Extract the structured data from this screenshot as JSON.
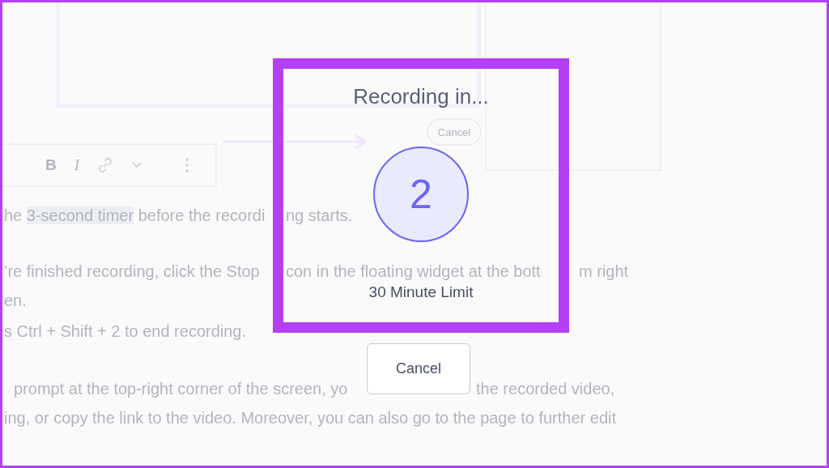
{
  "document": {
    "figure": {
      "button": "Cancel"
    },
    "toolbar": {
      "items": [
        {
          "kind": "bold",
          "label": "B"
        },
        {
          "kind": "italic",
          "label": "I"
        },
        {
          "kind": "link"
        },
        {
          "kind": "chevron"
        },
        {
          "kind": "more"
        }
      ]
    },
    "framed_lines": [
      {
        "left": [
          {
            "text": "he ",
            "highlighted": false
          },
          {
            "text": "3-second timer",
            "highlighted": true
          },
          {
            "text": " before the recordi",
            "highlighted": false
          }
        ],
        "inside": "ng starts."
      },
      {
        "left": [
          {
            "text": "’re finished recording, click the Stop",
            "highlighted": false
          }
        ],
        "inside": "con in the floating widget at the bott",
        "right": "m right"
      },
      {
        "left": [
          {
            "text": "en.",
            "highlighted": false
          }
        ]
      },
      {
        "left": [
          {
            "text": "s Ctrl + Shift + 2 to end recording.",
            "highlighted": false
          }
        ]
      }
    ],
    "lines": [
      {
        "text": "prompt at the top-right corner of the screen, yo",
        "after_button": "the recorded video,"
      },
      {
        "text": "ing, or copy the link to the video. Moreover, you can also go to the page to further edit"
      }
    ]
  },
  "dialog": {
    "title": "Recording in...",
    "countdown": "2",
    "limit": "30 Minute Limit",
    "cancel": "Cancel"
  }
}
